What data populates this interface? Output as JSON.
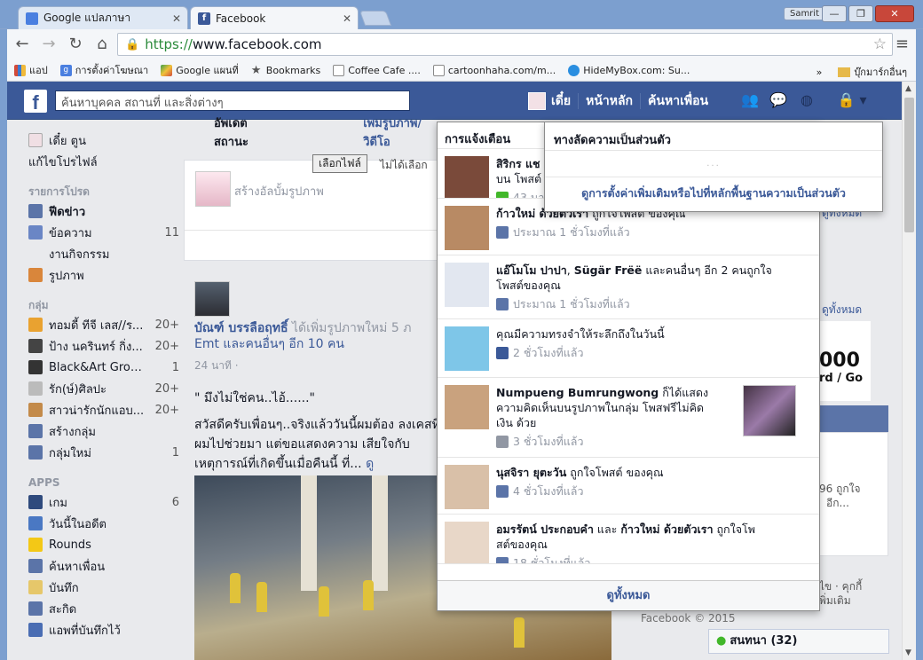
{
  "browser": {
    "tabs": [
      {
        "title": "Google แปลภาษา",
        "active": false
      },
      {
        "title": "Facebook",
        "active": true
      }
    ],
    "user_label": "Samrit",
    "url_scheme": "https://",
    "url_host": "www.facebook.com",
    "bookmarks": [
      {
        "label": "แอป",
        "icon": "apps-icon"
      },
      {
        "label": "การตั้งค่าโฆษณา",
        "icon": "google-icon"
      },
      {
        "label": "Google แผนที่",
        "icon": "maps-icon"
      },
      {
        "label": "Bookmarks",
        "icon": "star-icon"
      },
      {
        "label": "Coffee Cafe ....",
        "icon": "page-icon"
      },
      {
        "label": "cartoonhaha.com/m...",
        "icon": "page-icon"
      },
      {
        "label": "HideMyBox.com: Su...",
        "icon": "cloud-icon"
      }
    ],
    "other_bookmarks": "บุ๊กมาร์กอื่นๆ"
  },
  "fb": {
    "logo": "f",
    "search_placeholder": "ค้นหาบุคคล สถานที่ และสิ่งต่างๆ",
    "nav": {
      "user": "เดี๋ย",
      "home": "หน้าหลัก",
      "find_friends": "ค้นหาเพื่อน"
    }
  },
  "sidebar": {
    "profile_name": "เดี๋ย ตูน",
    "edit_profile": "แก้ไขโปรไฟล์",
    "favorites_header": "รายการโปรด",
    "favorites": [
      {
        "label": "ฟีดข่าว",
        "count": "",
        "bold": true,
        "icon": "news-feed-icon",
        "color": "#5b74a8"
      },
      {
        "label": "ข้อความ",
        "count": "11",
        "bold": false,
        "icon": "messages-icon",
        "color": "#6a86c5"
      },
      {
        "label": "งานกิจกรรม",
        "count": "",
        "bold": false,
        "icon": "",
        "color": ""
      },
      {
        "label": "รูปภาพ",
        "count": "",
        "bold": false,
        "icon": "photos-icon",
        "color": "#d9863b"
      }
    ],
    "groups_header": "กลุ่ม",
    "groups": [
      {
        "label": "ทอมดี้ ทีจี เลส//ร...",
        "count": "20+",
        "icon": "sun-icon",
        "color": "#e9a230"
      },
      {
        "label": "ป้าง นครินทร์ กิ่ง...",
        "count": "20+",
        "icon": "music-icon",
        "color": "#444"
      },
      {
        "label": "Black&Art Group...",
        "count": "1",
        "icon": "art-icon",
        "color": "#333"
      },
      {
        "label": "รัก(ษ์)ศิลปะ",
        "count": "20+",
        "icon": "heart-icon",
        "color": "#bbb"
      },
      {
        "label": "สาวน่ารักนักแอบ...",
        "count": "20+",
        "icon": "bear-icon",
        "color": "#c38a4a"
      },
      {
        "label": "สร้างกลุ่ม",
        "count": "",
        "icon": "plus-icon",
        "color": "#5b74a8"
      },
      {
        "label": "กลุ่มใหม่",
        "count": "1",
        "icon": "group-icon",
        "color": "#5b74a8"
      }
    ],
    "apps_header": "APPS",
    "apps": [
      {
        "label": "เกม",
        "count": "6",
        "icon": "games-icon",
        "color": "#2f4a7d"
      },
      {
        "label": "วันนี้ในอดีต",
        "count": "",
        "icon": "on-this-day-icon",
        "color": "#4a78c3"
      },
      {
        "label": "Rounds",
        "count": "",
        "icon": "rounds-icon",
        "color": "#f3c816"
      },
      {
        "label": "ค้นหาเพื่อน",
        "count": "",
        "icon": "find-friends-icon",
        "color": "#5b74a8"
      },
      {
        "label": "บันทึก",
        "count": "",
        "icon": "notes-icon",
        "color": "#e6c76a"
      },
      {
        "label": "สะกิด",
        "count": "",
        "icon": "poke-icon",
        "color": "#5b74a8"
      },
      {
        "label": "แอพที่บันทึกไว้",
        "count": "",
        "icon": "saved-icon",
        "color": "#4a6db3"
      }
    ]
  },
  "composer": {
    "tab_status": "อัพเดตสถานะ",
    "tab_photo": "เพิ่มรูปภาพ/วิดีโอ",
    "choose_file": "เลือกไฟล์",
    "no_file": "ไม่ได้เลือก",
    "placeholder": "สร้างอัลบั้มรูปภาพ"
  },
  "post": {
    "author": "บัณฑ์ บรรลือฤทธิ์",
    "action": " ได้เพิ่มรูปภาพใหม่ 5 ภ",
    "action2": "Emt และคนอื่นๆ อีก 10 คน",
    "time": "24 นาที ·",
    "quote": "\" มึงไม่ใช่คน..ไอ้......\"",
    "body": "สวัสดีครับเพื่อนๆ..จริงแล้ววันนี้ผมต้อง ลงเคสที่ผมไปช่วยมา แต่ขอแสดงความ เสียใจกับเหตุการณ์ที่เกิดขึ้นเมื่อคืนนี้ ที่...",
    "more": "ดู"
  },
  "notifications": {
    "header": "การแจ้งเตือน",
    "footer": "ดูทั้งหมด",
    "items": [
      {
        "text_bold": "สิริกร แช",
        "text": "",
        "line2": "บน โพสต์",
        "meta": "43 นา",
        "meta_icon": "comment-icon",
        "meta_color": "#42b72a"
      },
      {
        "text_bold": "ก้าวใหม่ ด้วยตัวเรา",
        "text": " ถูกใจโพสต์ ของคุณ",
        "line2": "",
        "meta": "ประมาณ 1 ชั่วโมงที่แล้ว",
        "meta_icon": "like-icon",
        "meta_color": "#5b74a8"
      },
      {
        "text_bold": "แอ๊โมโม ปาปา",
        "text": ", ",
        "text_bold2": "Sügär Frëë",
        "text3": " และคนอื่นๆ อีก 2 คนถูกใจ",
        "line2": "โพสต์ของคุณ",
        "meta": "ประมาณ 1 ชั่วโมงที่แล้ว",
        "meta_icon": "like-icon",
        "meta_color": "#5b74a8"
      },
      {
        "text_bold": "",
        "text": "คุณมีความทรงจำให้ระลึกถึงในวันนี้",
        "line2": "",
        "meta": "2 ชั่วโมงที่แล้ว",
        "meta_icon": "facebook-icon",
        "meta_color": "#3b5998"
      },
      {
        "text_bold": "Numpueng Bumrungwong",
        "text": " ก็ได้แสดง",
        "line2": "ความคิดเห็นบนรูปภาพในกลุ่ม โพสฟรีไม่คิด",
        "line3": "เงิน ด้วย",
        "meta": "3 ชั่วโมงที่แล้ว",
        "meta_icon": "megaphone-icon",
        "meta_color": "#9197a3"
      },
      {
        "text_bold": "นุสจิรา ยุตะวัน",
        "text": " ถูกใจโพสต์ ของคุณ",
        "line2": "",
        "meta": "4 ชั่วโมงที่แล้ว",
        "meta_icon": "like-icon",
        "meta_color": "#5b74a8"
      },
      {
        "text_bold": "อมรรัตน์ ประกอบคำ",
        "text": " และ ",
        "text_bold2": "ก้าวใหม่ ด้วยตัวเรา",
        "text3": " ถูกใจโพ",
        "line2": "สต์ของคุณ",
        "meta": "18 ชั่วโมงที่แล้ว",
        "meta_icon": "like-icon",
        "meta_color": "#5b74a8"
      }
    ]
  },
  "privacy": {
    "header": "ทางลัดความเป็นส่วนตัว",
    "loading": "...",
    "link": "ดูการตั้งค่าเพิ่มเติมหรือไปที่หลักพื้นฐานความเป็นส่วนตัว"
  },
  "right": {
    "see_all": "ดูทั้งหมด",
    "partial1": "ดูทั้งหมด",
    "ad_text": "000",
    "ad_sub": "rd / Go",
    "partial_likes": "96 ถูกใจ",
    "partial_more": "อีก...",
    "partial_footer": "ไข · คุกกี้",
    "partial_footer2": "พิ่มเติม",
    "copyright": "Facebook © 2015",
    "chat": "สนทนา (32)"
  }
}
